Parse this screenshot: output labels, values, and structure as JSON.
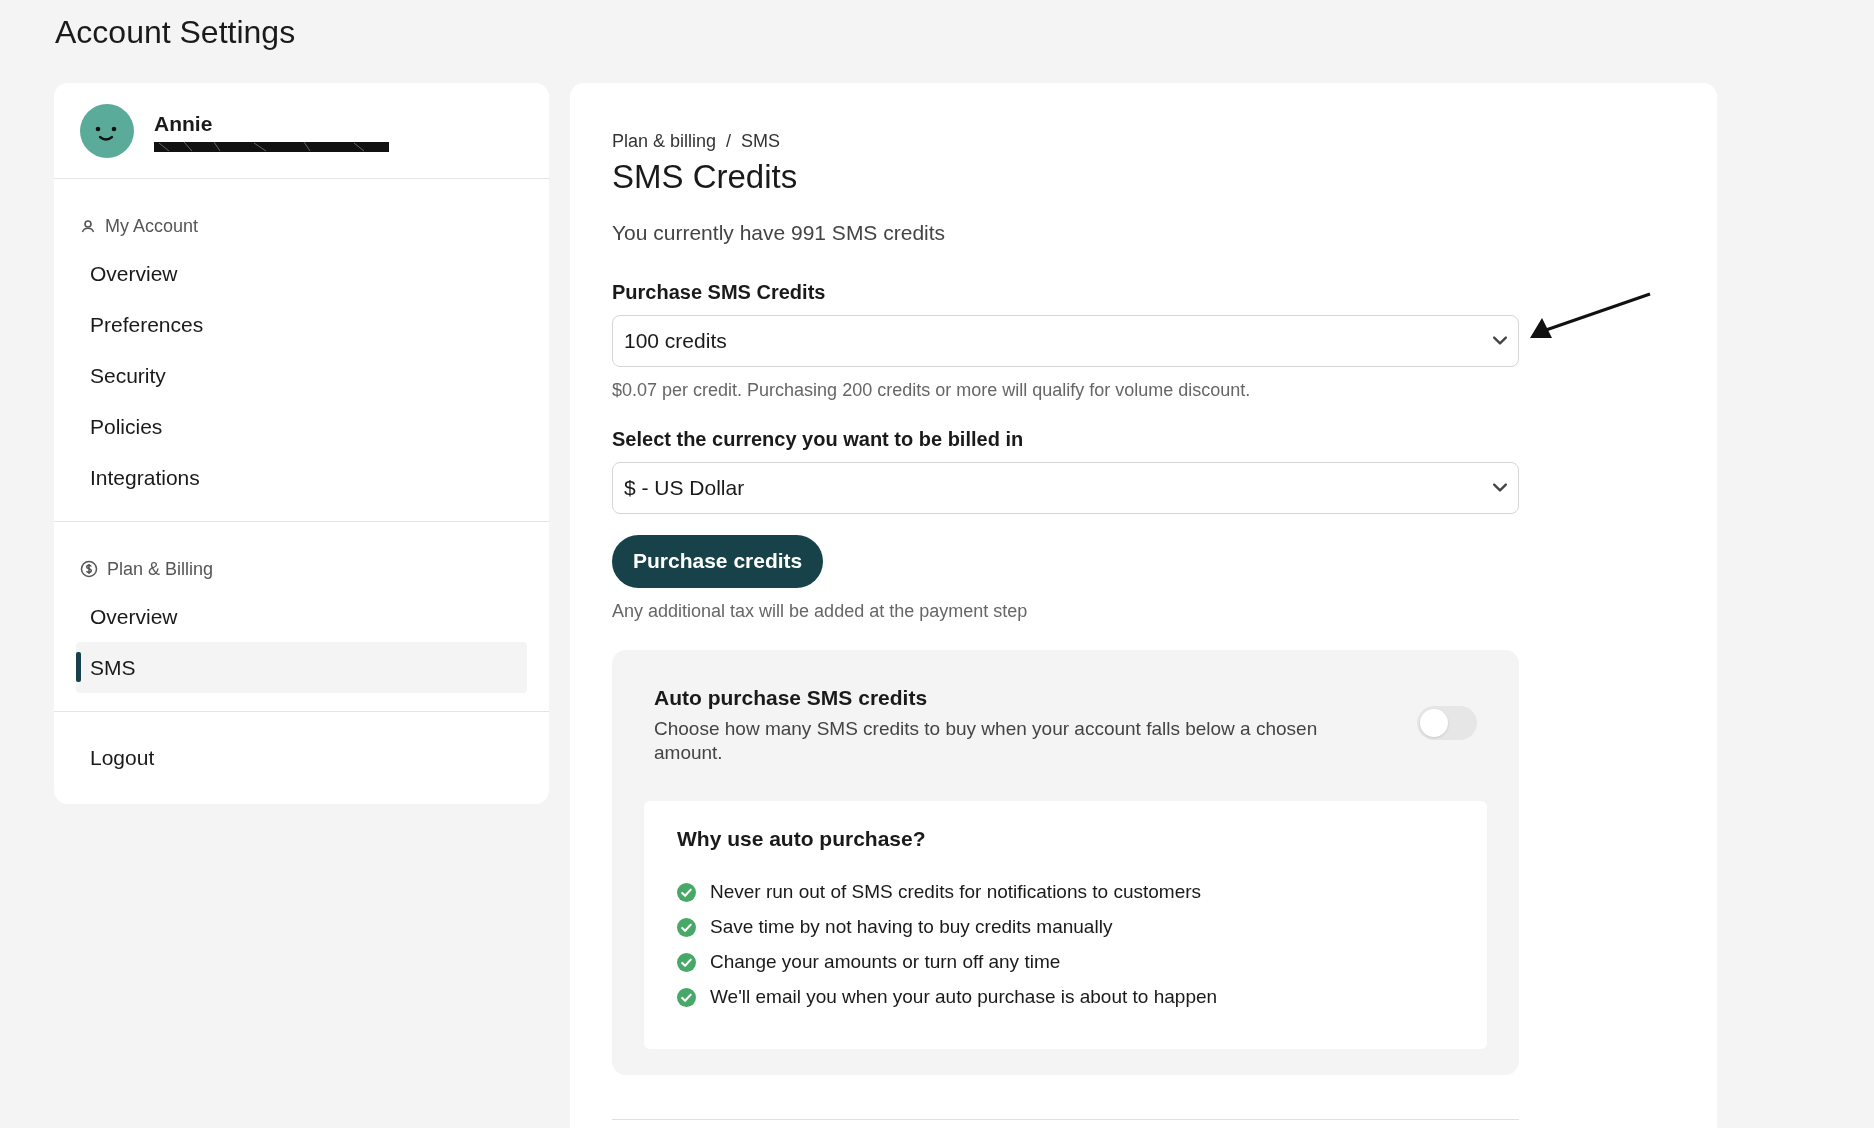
{
  "page_title": "Account Settings",
  "profile": {
    "name": "Annie",
    "email_redacted": true
  },
  "sidebar": {
    "sections": [
      {
        "heading": "My Account",
        "kind": "account",
        "items": [
          {
            "label": "Overview",
            "selected": false
          },
          {
            "label": "Preferences",
            "selected": false
          },
          {
            "label": "Security",
            "selected": false
          },
          {
            "label": "Policies",
            "selected": false
          },
          {
            "label": "Integrations",
            "selected": false
          }
        ]
      },
      {
        "heading": "Plan & Billing",
        "kind": "billing",
        "items": [
          {
            "label": "Overview",
            "selected": false
          },
          {
            "label": "SMS",
            "selected": true
          }
        ]
      }
    ],
    "logout": "Logout"
  },
  "breadcrumb": {
    "items": [
      "Plan & billing",
      "SMS"
    ],
    "separator": "/"
  },
  "title": "SMS Credits",
  "balance": "You currently have 991 SMS credits",
  "purchase": {
    "label": "Purchase SMS Credits",
    "value": "100 credits",
    "help": "$0.07 per credit. Purchasing 200 credits or more will qualify for volume discount."
  },
  "currency": {
    "label": "Select the currency you want to be billed in",
    "value": "$ - US Dollar"
  },
  "button": "Purchase credits",
  "tax_note": "Any additional tax will be added at the payment step",
  "auto": {
    "title": "Auto purchase SMS credits",
    "description": "Choose how many SMS credits to buy when your account falls below a chosen amount.",
    "on": false,
    "why": {
      "title": "Why use auto purchase?",
      "items": [
        "Never run out of SMS credits for notifications to customers",
        "Save time by not having to buy credits manually",
        "Change your amounts or turn off any time",
        "We'll email you when your auto purchase is about to happen"
      ]
    }
  }
}
